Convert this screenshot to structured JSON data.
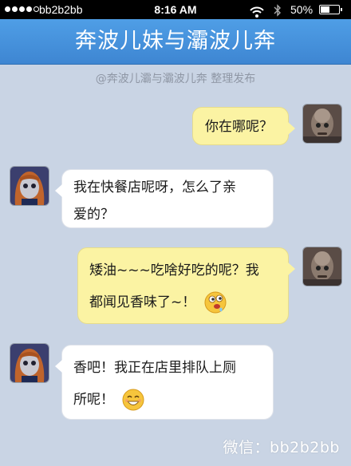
{
  "status_bar": {
    "carrier": "bb2b2bb",
    "time": "8:16 AM",
    "battery": "50%",
    "battery_level": 0.5,
    "signal_bars": 4
  },
  "title": "奔波儿妹与灞波儿奔",
  "credit": "@奔波儿灞与灞波儿奔 整理发布",
  "messages": [
    {
      "side": "right",
      "lines": [
        "你在哪呢？"
      ]
    },
    {
      "side": "left",
      "lines": [
        "我在快餐店呢呀，怎么了亲",
        "爱的？"
      ]
    },
    {
      "side": "right",
      "lines": [
        "矮油~~~吃啥好吃的呢？我",
        "都闻见香味了~！"
      ],
      "emoji": "drooling-face-icon"
    },
    {
      "side": "left",
      "lines": [
        "香吧！我正在店里排队上厕",
        "所呢！"
      ],
      "emoji": "smiling-face-icon"
    }
  ],
  "watermark": "微信：bb2b2bb",
  "colors": {
    "title_bar": "#4a96e0",
    "background": "#c9d4e4",
    "right_bubble": "#fbf3a3",
    "left_bubble": "#ffffff"
  }
}
